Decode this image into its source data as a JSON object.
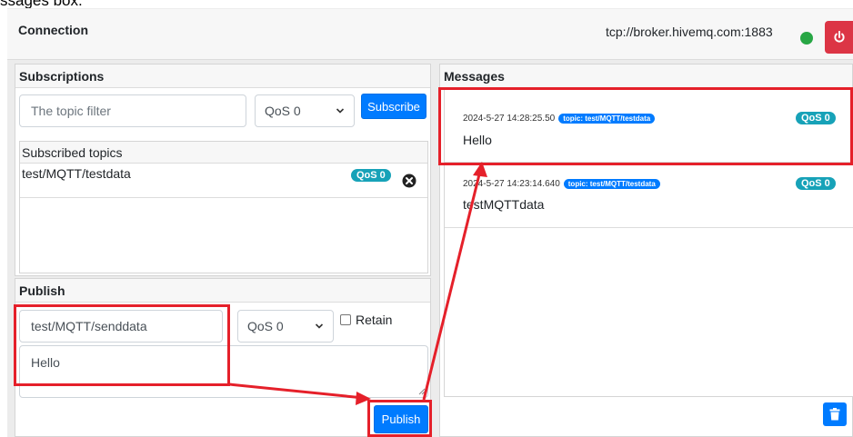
{
  "caption": "ssages box.",
  "connection": {
    "title": "Connection",
    "url": "tcp://broker.hivemq.com:1883",
    "status_color": "#28a745",
    "disconnect_icon": "power-icon"
  },
  "subscriptions": {
    "title": "Subscriptions",
    "topic_placeholder": "The topic filter",
    "qos_selected": "QoS 0",
    "subscribe_label": "Subscribe",
    "list_title": "Subscribed topics",
    "items": [
      {
        "topic": "test/MQTT/testdata",
        "qos": "QoS 0",
        "remove_icon": "close-circle-icon"
      }
    ]
  },
  "publish": {
    "title": "Publish",
    "topic_value": "test/MQTT/senddata",
    "qos_selected": "QoS 0",
    "retain_label": "Retain",
    "retain_checked": false,
    "message_value": "Hello",
    "publish_label": "Publish"
  },
  "messages": {
    "title": "Messages",
    "items": [
      {
        "timestamp": "2024-5-27 14:28:25.50",
        "topic": "topic: test/MQTT/testdata",
        "qos": "QoS 0",
        "body": "Hello"
      },
      {
        "timestamp": "2024-5-27 14:23:14.640",
        "topic": "topic: test/MQTT/testdata",
        "qos": "QoS 0",
        "body": "testMQTTdata"
      }
    ],
    "clear_icon": "trash-icon"
  },
  "colors": {
    "primary": "#007bff",
    "danger": "#dc3545",
    "info": "#17a2b8",
    "highlight": "#e5202a"
  }
}
